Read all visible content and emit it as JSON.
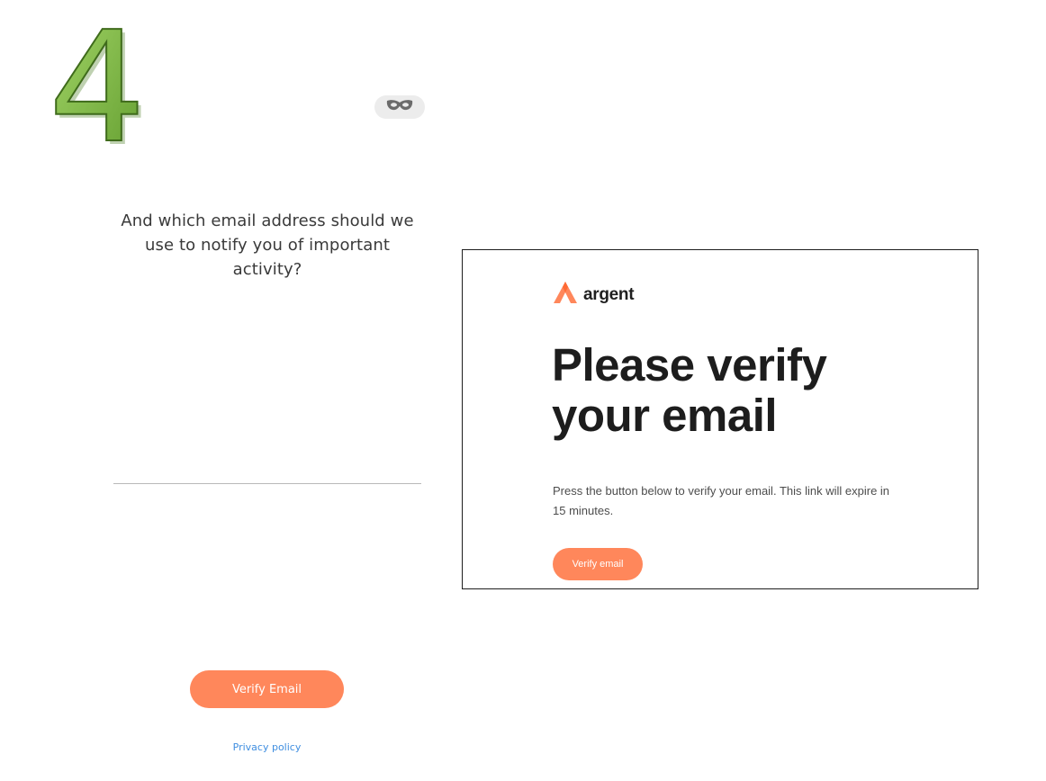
{
  "step": {
    "number": "4",
    "color": "#7ab840"
  },
  "mask_toggle": {
    "icon": "mask-icon"
  },
  "question": {
    "text": "And which email address should we use to notify you of important activity?"
  },
  "email_input": {
    "value": "",
    "placeholder": ""
  },
  "primary_button": {
    "label": "Verify Email",
    "color": "#ff875b"
  },
  "privacy": {
    "label": "Privacy policy",
    "color": "#3f8ee0"
  },
  "email_preview": {
    "brand": {
      "name": "argent",
      "icon": "argent-logo-icon",
      "color": "#ff875b"
    },
    "title": "Please verify your email",
    "body": "Press the button below to verify your email. This link will expire in 15 minutes.",
    "button_label": "Verify email"
  }
}
